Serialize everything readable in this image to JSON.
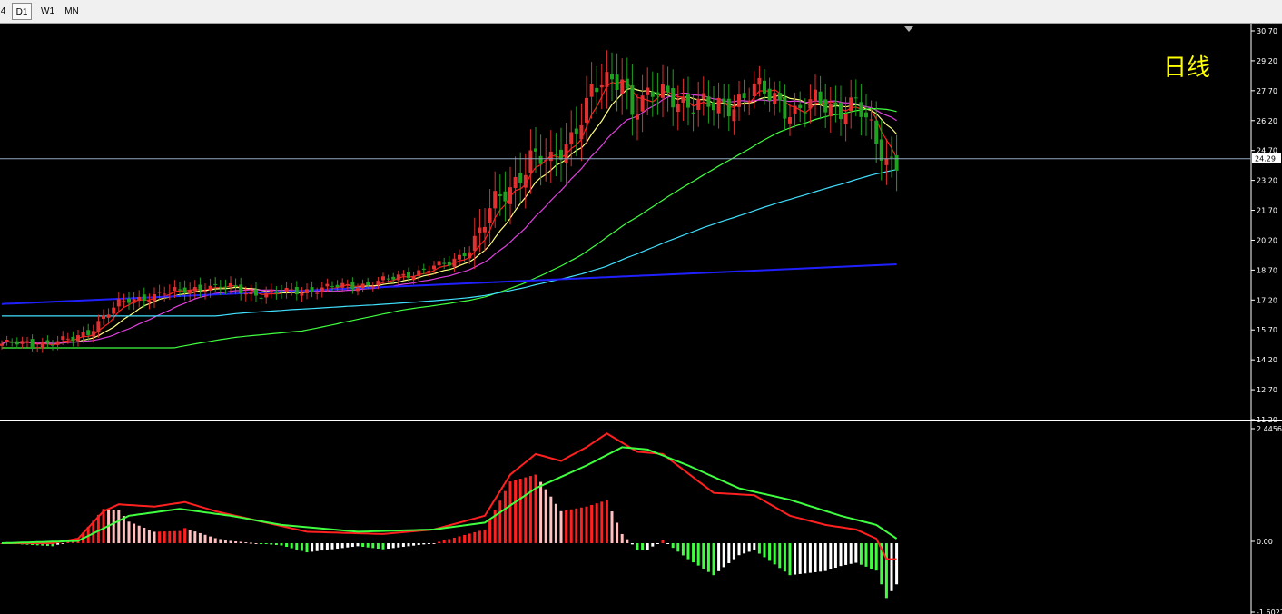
{
  "toolbar": {
    "timeframes": [
      {
        "label": "4",
        "active": false
      },
      {
        "label": "D1",
        "active": true
      },
      {
        "label": "W1",
        "active": false
      },
      {
        "label": "MN",
        "active": false
      }
    ]
  },
  "chart_data": {
    "type": "candlestick",
    "title": "日线",
    "main": {
      "y_ticks": [
        "30.70",
        "29.20",
        "27.70",
        "26.20",
        "24.70",
        "23.20",
        "21.70",
        "20.20",
        "18.70",
        "17.20",
        "15.70",
        "14.20",
        "12.70",
        "11.20"
      ],
      "last_price": "24.29",
      "key_closes": [
        15.0,
        15.0,
        15.1,
        15.2,
        15.6,
        16.4,
        17.0,
        17.2,
        17.4,
        17.6,
        17.6,
        17.9,
        17.8,
        17.6,
        17.5,
        17.6,
        17.7,
        17.8,
        17.9,
        18.0,
        18.2,
        18.5,
        18.8,
        19.0,
        19.8,
        21.6,
        22.8,
        24.5,
        23.9,
        25.5,
        27.6,
        28.1,
        28.5,
        26.9,
        27.4,
        27.5,
        27.0,
        26.8,
        27.2,
        27.7,
        27.3,
        26.7,
        27.0,
        26.9,
        27.1,
        25.0,
        24.3,
        24.3
      ],
      "key_index": [
        0,
        6,
        10,
        14,
        17,
        20,
        23,
        26,
        29,
        32,
        35,
        40,
        45,
        48,
        52,
        56,
        60,
        64,
        68,
        72,
        76,
        80,
        84,
        88,
        92,
        96,
        100,
        104,
        108,
        112,
        116,
        120,
        122,
        124,
        128,
        132,
        136,
        140,
        144,
        148,
        152,
        156,
        160,
        164,
        168,
        172,
        174,
        176
      ],
      "n_bars": 177,
      "ma_colors": [
        "#ff2020",
        "#ffff80",
        "#e040e0",
        "#40ff40",
        "#40e0ff",
        "#2020ff"
      ],
      "bull_color": "#e03030",
      "bear_color": "#20a020"
    },
    "macd": {
      "y_ticks": [
        "2.4456",
        "0.00",
        "-1.6027"
      ],
      "dif": [
        [
          0,
          0.0
        ],
        [
          10,
          0.0
        ],
        [
          15,
          0.1
        ],
        [
          20,
          0.7
        ],
        [
          23,
          0.85
        ],
        [
          30,
          0.8
        ],
        [
          36,
          0.9
        ],
        [
          42,
          0.7
        ],
        [
          50,
          0.5
        ],
        [
          60,
          0.25
        ],
        [
          75,
          0.2
        ],
        [
          85,
          0.3
        ],
        [
          95,
          0.6
        ],
        [
          100,
          1.5
        ],
        [
          105,
          1.95
        ],
        [
          110,
          1.8
        ],
        [
          115,
          2.1
        ],
        [
          119,
          2.4
        ],
        [
          125,
          2.0
        ],
        [
          130,
          1.95
        ],
        [
          140,
          1.1
        ],
        [
          148,
          1.05
        ],
        [
          155,
          0.6
        ],
        [
          162,
          0.4
        ],
        [
          168,
          0.3
        ],
        [
          172,
          0.1
        ],
        [
          174,
          -0.35
        ]
      ],
      "dea": [
        [
          0,
          0.0
        ],
        [
          15,
          0.05
        ],
        [
          25,
          0.6
        ],
        [
          35,
          0.75
        ],
        [
          45,
          0.6
        ],
        [
          55,
          0.4
        ],
        [
          70,
          0.25
        ],
        [
          85,
          0.3
        ],
        [
          95,
          0.45
        ],
        [
          105,
          1.2
        ],
        [
          115,
          1.7
        ],
        [
          122,
          2.1
        ],
        [
          127,
          2.05
        ],
        [
          135,
          1.7
        ],
        [
          145,
          1.2
        ],
        [
          155,
          0.95
        ],
        [
          165,
          0.6
        ],
        [
          172,
          0.4
        ],
        [
          176,
          0.1
        ]
      ],
      "bar_colors": [
        "#ff2020",
        "#ffc0c0",
        "#40ff40",
        "#ffffff"
      ]
    }
  }
}
